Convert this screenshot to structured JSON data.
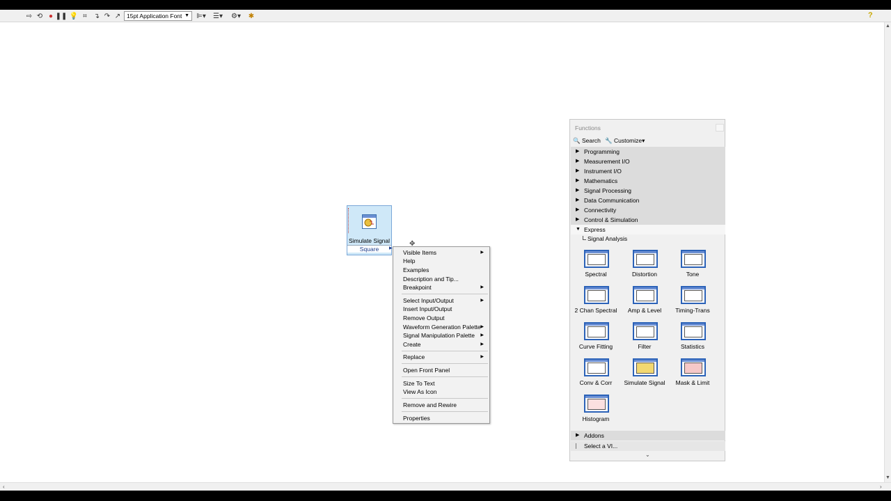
{
  "toolbar": {
    "font_select": "15pt Application Font",
    "icons": [
      "run-arrow-icon",
      "run-continuous-icon",
      "abort-icon",
      "pause-icon",
      "highlight-execution-icon",
      "retain-wire-values-icon",
      "step-into-icon",
      "step-over-icon",
      "step-out-icon",
      "align-icon",
      "distribute-icon",
      "reorder-icon",
      "cleanup-icon",
      "help-icon"
    ]
  },
  "node": {
    "title": "Simulate Signal",
    "output": "Square"
  },
  "context_menu": {
    "items": [
      {
        "label": "Visible Items",
        "submenu": true
      },
      {
        "label": "Help",
        "submenu": false
      },
      {
        "label": "Examples",
        "submenu": false
      },
      {
        "label": "Description and Tip...",
        "submenu": false
      },
      {
        "label": "Breakpoint",
        "submenu": true
      },
      {
        "label": "Select Input/Output",
        "submenu": true
      },
      {
        "label": "Insert Input/Output",
        "submenu": false
      },
      {
        "label": "Remove Output",
        "submenu": false
      },
      {
        "label": "Waveform Generation Palette",
        "submenu": true
      },
      {
        "label": "Signal Manipulation Palette",
        "submenu": true
      },
      {
        "label": "Create",
        "submenu": true
      },
      {
        "label": "Replace",
        "submenu": true
      },
      {
        "label": "Open Front Panel",
        "submenu": false
      },
      {
        "label": "Size To Text",
        "submenu": false
      },
      {
        "label": "View As Icon",
        "submenu": false
      },
      {
        "label": "Remove and Rewire",
        "submenu": false
      },
      {
        "label": "Properties",
        "submenu": false
      }
    ]
  },
  "palette": {
    "title": "Functions",
    "search_label": "Search",
    "customize_label": "Customize▾",
    "categories": [
      "Programming",
      "Measurement I/O",
      "Instrument I/O",
      "Mathematics",
      "Signal Processing",
      "Data Communication",
      "Connectivity",
      "Control & Simulation"
    ],
    "express_label": "Express",
    "subcategory": "Signal Analysis",
    "tiles": [
      "Spectral",
      "Distortion",
      "Tone",
      "2 Chan Spectral",
      "Amp & Level",
      "Timing-Trans",
      "Curve Fitting",
      "Filter",
      "Statistics",
      "Conv & Corr",
      "Simulate Signal",
      "Mask & Limit",
      "Histogram"
    ],
    "addons_label": "Addons",
    "select_vi_label": "Select a VI..."
  }
}
